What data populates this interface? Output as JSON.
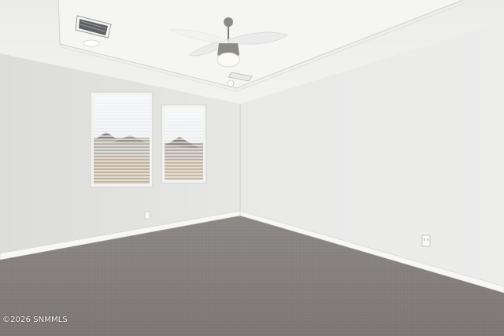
{
  "photo": {
    "subject": "empty-bedroom",
    "watermark": "©2026 SNMMLS"
  },
  "colors": {
    "left_wall": "#e4e4e2",
    "right_wall": "#ececeb",
    "ceiling": "#efefed",
    "tray_ceiling": "#f3f3f2",
    "carpet": "#85807d",
    "baseboard": "#f7f7f6"
  },
  "icons": {
    "ceiling_fan": "ceiling-fan-icon",
    "vent": "air-vent-icon",
    "recessed_light": "recessed-light-icon",
    "outlet": "wall-outlet-icon"
  }
}
